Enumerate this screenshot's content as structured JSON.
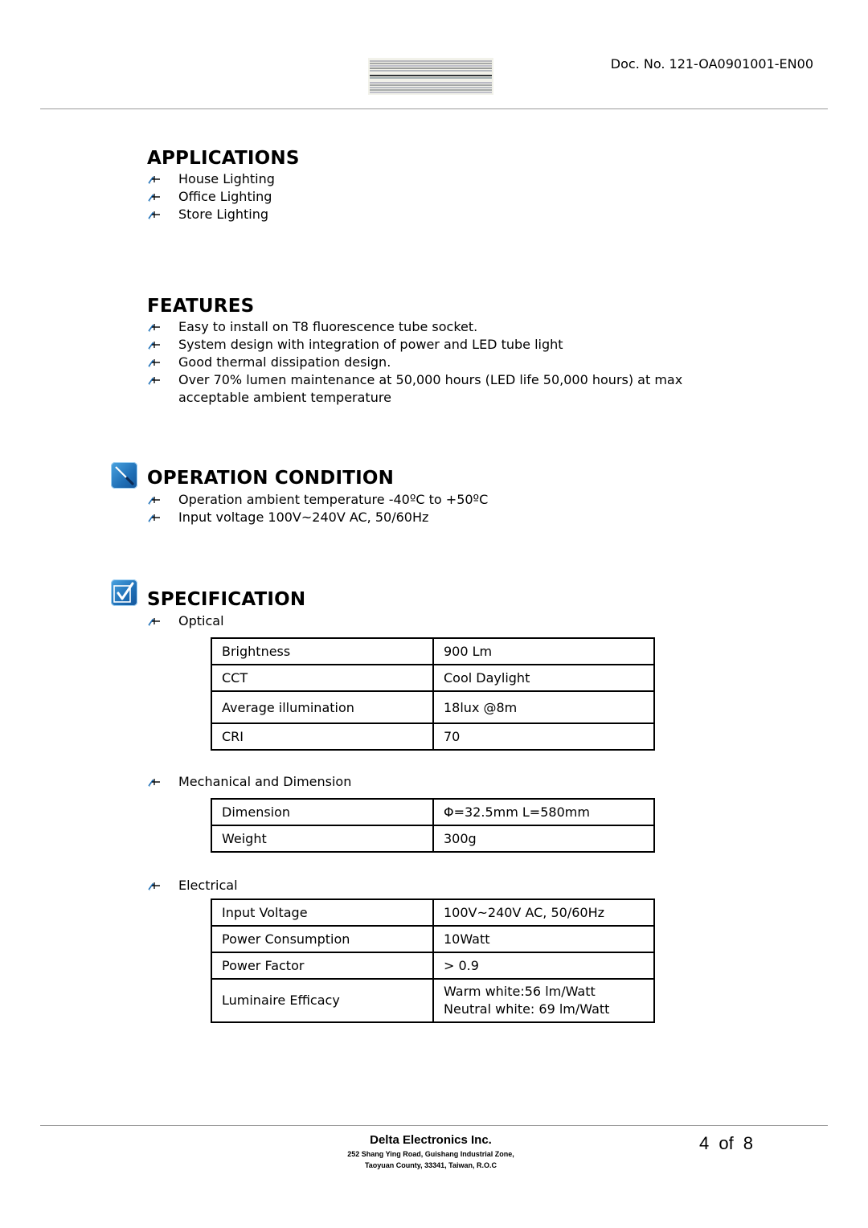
{
  "header": {
    "doc_number": "Doc. No. 121-OA0901001-EN00",
    "product_image": "led-tube-image"
  },
  "applications": {
    "title": "APPLICATIONS",
    "items": [
      "House Lighting",
      "Office Lighting",
      "Store Lighting"
    ]
  },
  "features": {
    "title": "FEATURES",
    "items": [
      "Easy to install on T8 fluorescence tube socket.",
      "System design with integration of power and LED tube light",
      "Good thermal dissipation design.",
      "Over 70% lumen maintenance at 50,000 hours (LED life 50,000 hours) at max",
      "acceptable ambient temperature"
    ]
  },
  "operation_condition": {
    "title": "OPERATION CONDITION",
    "icon": "screwdriver-icon",
    "items": [
      "Operation ambient temperature -40ºC to +50ºC",
      "Input voltage 100V~240V AC, 50/60Hz"
    ]
  },
  "specification": {
    "title": "SPECIFICATION",
    "icon": "checkbox-icon",
    "optical": {
      "label": "Optical",
      "rows": [
        {
          "key": "Brightness",
          "value": "900 Lm"
        },
        {
          "key": "CCT",
          "value": "Cool Daylight"
        },
        {
          "key": "Average illumination",
          "value": "18lux @8m"
        },
        {
          "key": "CRI",
          "value": "70"
        }
      ]
    },
    "mechanical": {
      "label": "Mechanical and Dimension",
      "rows": [
        {
          "key": "Dimension",
          "value": "Φ=32.5mm L=580mm"
        },
        {
          "key": "Weight",
          "value": "300g"
        }
      ]
    },
    "electrical": {
      "label": "Electrical",
      "rows": [
        {
          "key": "Input Voltage",
          "value": "100V~240V AC, 50/60Hz"
        },
        {
          "key": "Power Consumption",
          "value": "10Watt"
        },
        {
          "key": "Power Factor",
          "value": "> 0.9"
        },
        {
          "key": "Luminaire Efficacy",
          "value": "Warm white:56 lm/Watt",
          "value2": "Neutral white: 69 lm/Watt"
        }
      ]
    }
  },
  "footer": {
    "company": "Delta Electronics Inc.",
    "address_line1": "252 Shang Ying Road, Guishang Industrial Zone,",
    "address_line2": "Taoyuan County, 33341, Taiwan, R.O.C",
    "page": "4 of 8"
  },
  "colors": {
    "icon_blue": "#1f6fb6",
    "rule_gray": "#9a9a9a"
  }
}
